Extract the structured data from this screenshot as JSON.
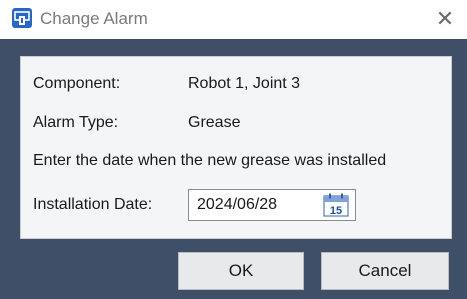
{
  "window": {
    "title": "Change Alarm",
    "close_glyph": "✕",
    "icon": "app-icon"
  },
  "fields": {
    "component_label": "Component:",
    "component_value": "Robot 1, Joint 3",
    "alarm_type_label": "Alarm Type:",
    "alarm_type_value": "Grease",
    "instruction": "Enter the date when the new grease was installed",
    "installation_date_label": "Installation Date:",
    "installation_date_value": "2024/06/28",
    "calendar_day": "15"
  },
  "buttons": {
    "ok_label": "OK",
    "cancel_label": "Cancel"
  },
  "colors": {
    "background": "#3f4f67",
    "panel": "#f4f5f7",
    "app_icon_blue": "#2b66c7"
  }
}
